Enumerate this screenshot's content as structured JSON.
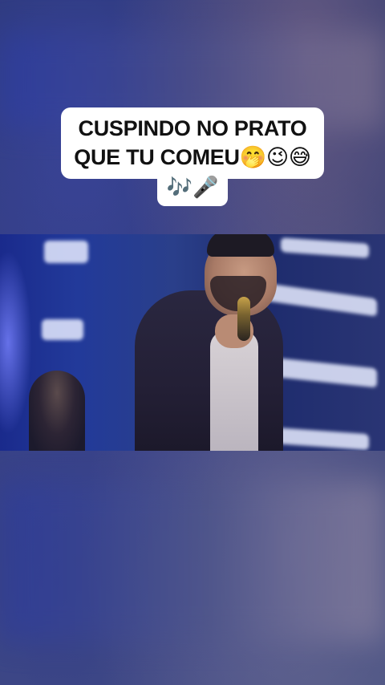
{
  "caption": {
    "line1": "CUSPINDO NO PRATO",
    "line2_text": "QUE TU COMEU",
    "line2_emojis": "🤭😉😅",
    "line3": "🎶🎤"
  },
  "colors": {
    "caption_bg": "#ffffff",
    "caption_text": "#111111",
    "stage_blue": "#223a9a"
  },
  "icons": {
    "emoji_set_line2": [
      "face-with-hand-over-mouth",
      "winking-face",
      "grinning-face-with-sweat"
    ],
    "emoji_set_line3": [
      "musical-notes",
      "microphone"
    ]
  }
}
